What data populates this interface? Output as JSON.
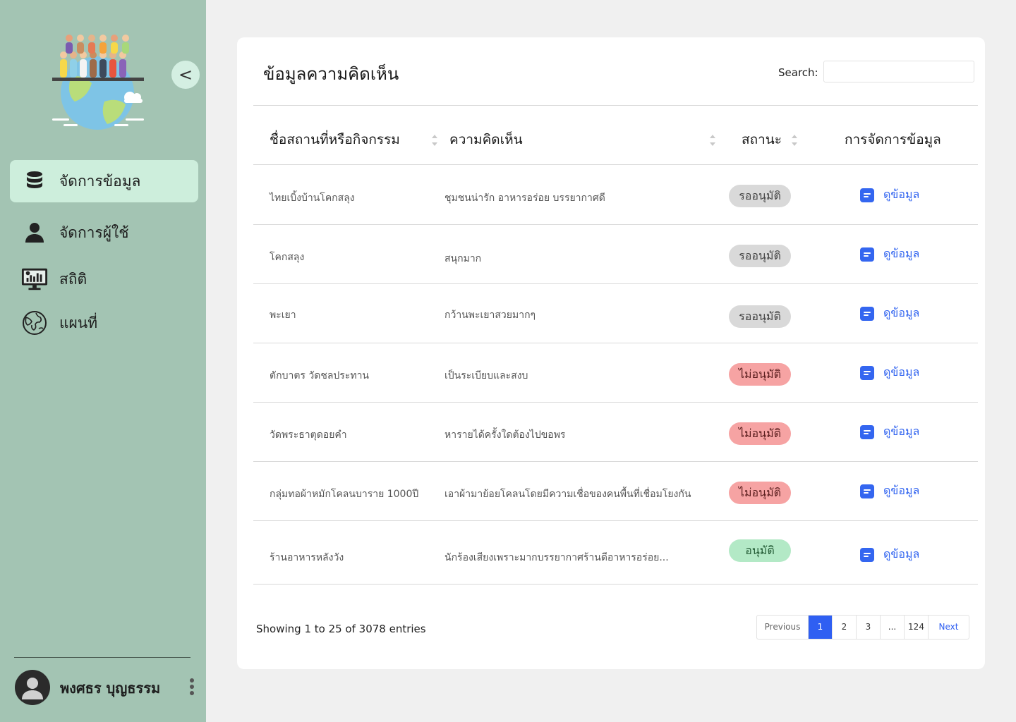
{
  "sidebar": {
    "collapse_label": "<",
    "nav": [
      {
        "label": "จัดการข้อมูล",
        "icon": "database-icon",
        "active": true
      },
      {
        "label": "จัดการผู้ใช้",
        "icon": "user-icon",
        "active": false
      },
      {
        "label": "สถิติ",
        "icon": "statistics-monitor-icon",
        "active": false
      },
      {
        "label": "แผนที่",
        "icon": "globe-icon",
        "active": false
      }
    ],
    "user_name": "พงศธร บุญธรรม"
  },
  "main": {
    "title": "ข้อมูลความคิดเห็น",
    "search_label": "Search:",
    "search_value": "",
    "columns": [
      "ชื่อสถานที่หรือกิจกรรม",
      "ความคิดเห็น",
      "สถานะ",
      "การจัดการข้อมูล"
    ],
    "rows": [
      {
        "place": "ไทยเบิ้งบ้านโคกสลุง",
        "comment": "ชุมชนน่ารัก อาหารอร่อย บรรยากาศดี",
        "status": "รออนุมัติ",
        "status_type": "pending",
        "action": "ดูข้อมูล"
      },
      {
        "place": "โคกสลุง",
        "comment": "สนุกมาก",
        "status": "รออนุมัติ",
        "status_type": "pending",
        "action": "ดูข้อมูล"
      },
      {
        "place": "พะเยา",
        "comment": "กว้านพะเยาสวยมากๆ",
        "status": "รออนุมัติ",
        "status_type": "pending",
        "action": "ดูข้อมูล"
      },
      {
        "place": "ตักบาตร วัดชลประทาน",
        "comment": "เป็นระเบียบและสงบ",
        "status": "ไม่อนุมัติ",
        "status_type": "rejected",
        "action": "ดูข้อมูล"
      },
      {
        "place": "วัดพระธาตุดอยคำ",
        "comment": "หารายได้ครั้งใดต้องไปขอพร",
        "status": "ไม่อนุมัติ",
        "status_type": "rejected",
        "action": "ดูข้อมูล"
      },
      {
        "place": "กลุ่มทอผ้าหมักโคลนบาราย 1000ปี",
        "comment": "เอาผ้ามาย้อยโคลนโดยมีความเชื่อของคนพื้นที่เชื่อมโยงกัน",
        "status": "ไม่อนุมัติ",
        "status_type": "rejected",
        "action": "ดูข้อมูล"
      },
      {
        "place": "ร้านอาหารหลังวัง",
        "comment": "นักร้องเสียงเพราะมากบรรยากาศร้านดีอาหารอร่อย...",
        "status": "อนุมัติ",
        "status_type": "approved",
        "action": "ดูข้อมูล"
      }
    ],
    "info": "Showing 1 to 25 of 3078 entries",
    "pagination": {
      "previous": "Previous",
      "pages": [
        "1",
        "2",
        "3",
        "...",
        "124"
      ],
      "current": "1",
      "next": "Next"
    }
  },
  "colors": {
    "sidebar_bg": "#a3c4b3",
    "active_nav": "#cdeedc",
    "accent_blue": "#3466f0",
    "pending": "#d9d9d9",
    "rejected": "#f6a3a3",
    "approved": "#b3e9c6"
  }
}
